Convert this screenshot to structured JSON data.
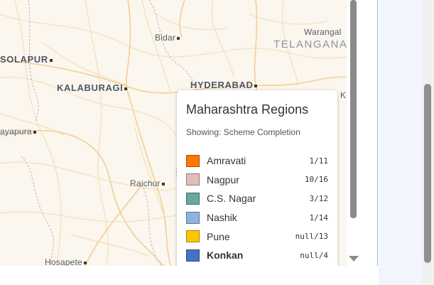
{
  "map": {
    "places": [
      {
        "label": "Warangal"
      },
      {
        "label": "TELANGANA"
      },
      {
        "label": "Bidar"
      },
      {
        "label": "SOLAPUR"
      },
      {
        "label": "KALABURAGI"
      },
      {
        "label": "HYDERABAD"
      },
      {
        "label": "ayapura"
      },
      {
        "label": "Raichur"
      },
      {
        "label": "Hosapete"
      },
      {
        "label": "K"
      }
    ]
  },
  "legend": {
    "title": "Maharashtra Regions",
    "subtitle": "Showing: Scheme Completion",
    "items": [
      {
        "name": "Amravati",
        "count": "1/11",
        "color": "#ff7700",
        "bold": false
      },
      {
        "name": "Nagpur",
        "count": "10/16",
        "color": "#e3bcbc",
        "bold": false
      },
      {
        "name": "C.S. Nagar",
        "count": "3/12",
        "color": "#66a8a4",
        "bold": false
      },
      {
        "name": "Nashik",
        "count": "1/14",
        "color": "#8fb3e0",
        "bold": false
      },
      {
        "name": "Pune",
        "count": "null/13",
        "color": "#ffc500",
        "bold": false
      },
      {
        "name": "Konkan",
        "count": "null/4",
        "color": "#4472c4",
        "bold": true
      }
    ]
  },
  "colors": {
    "accent_border": "#8ab4f0",
    "map_background": "#fbf6ee"
  }
}
